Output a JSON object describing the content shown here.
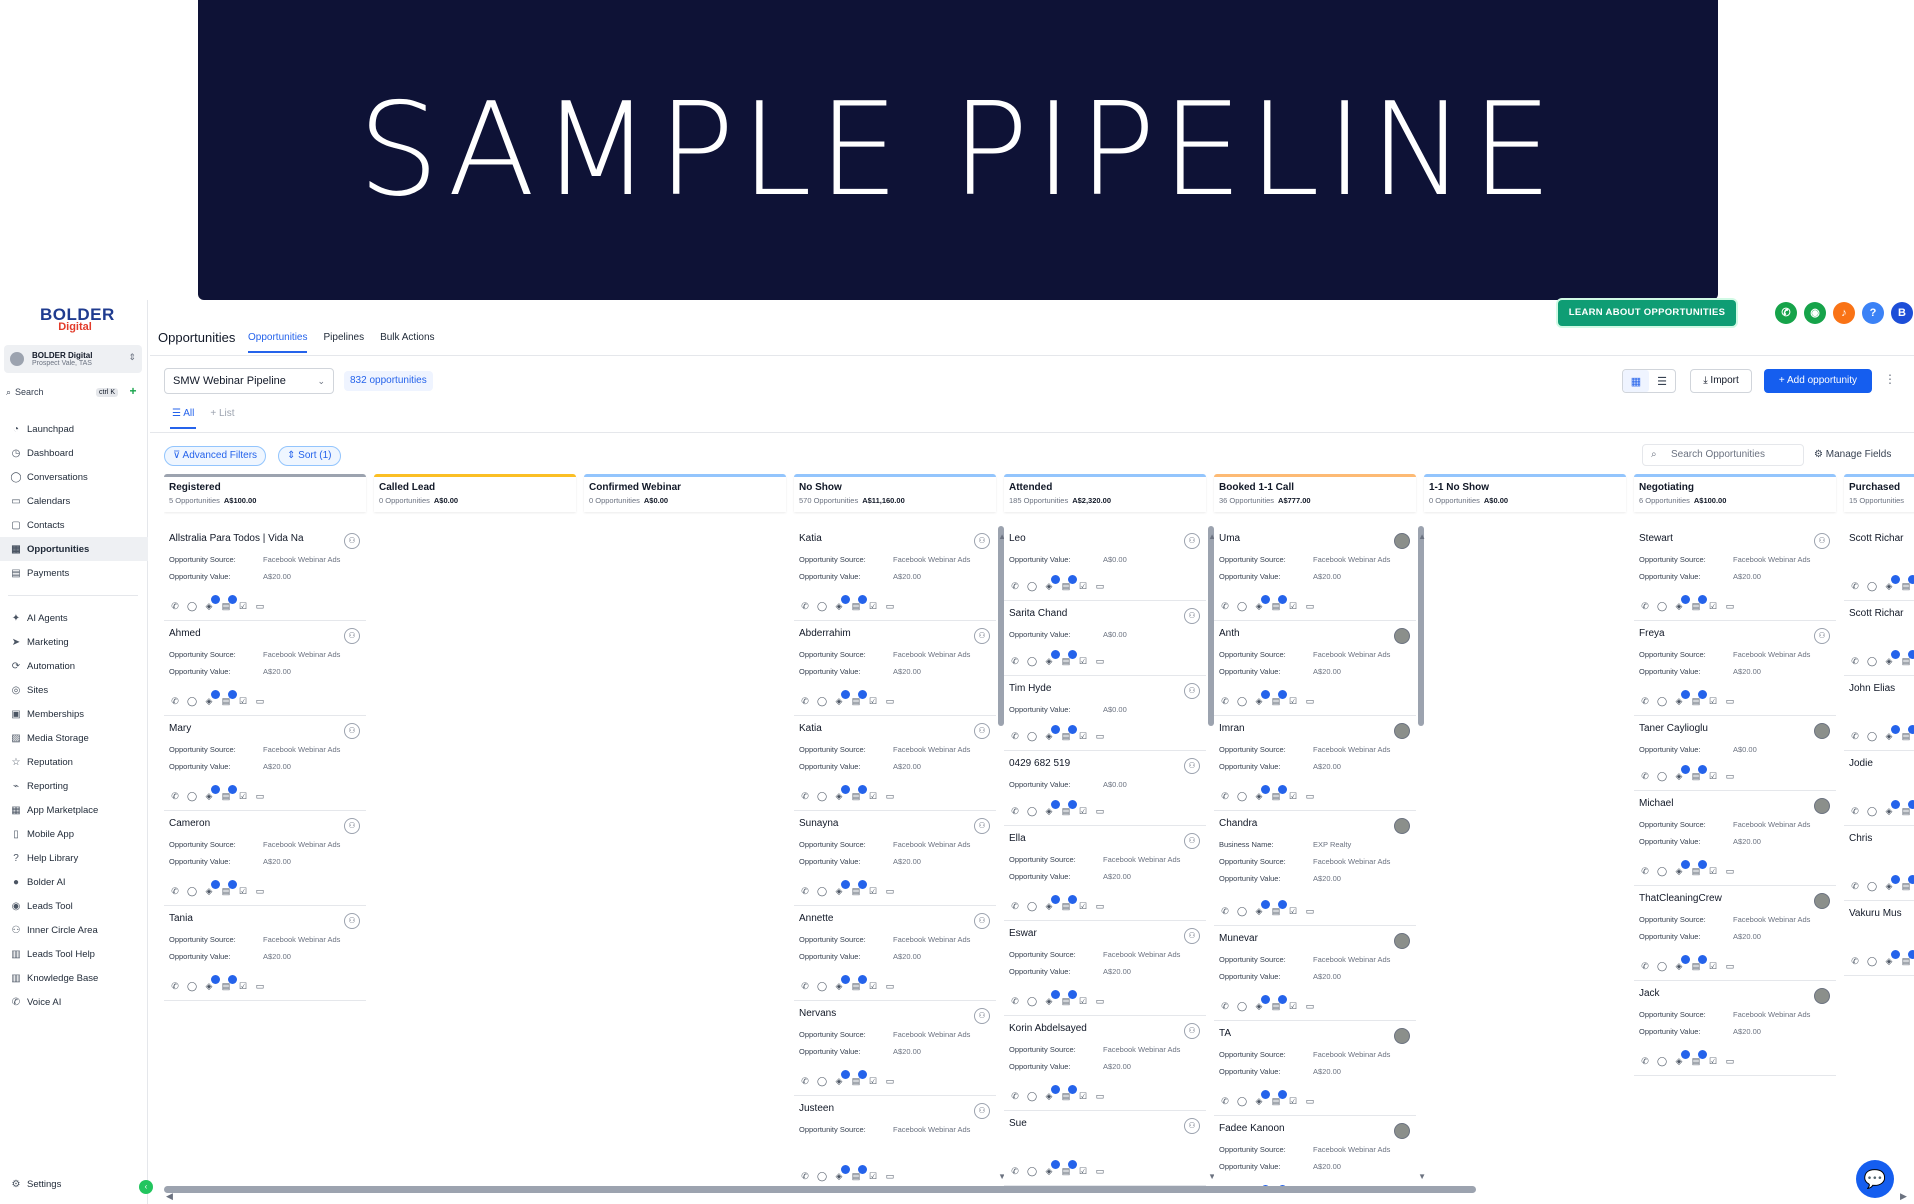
{
  "banner": {
    "title": "SAMPLE PIPELINE"
  },
  "brand": {
    "logo_line1": "BOLDER",
    "logo_line2": "Digital"
  },
  "account": {
    "name": "BOLDER Digital",
    "location": "Prospect Vale, TAS"
  },
  "search": {
    "label": "Search",
    "shortcut": "ctrl K"
  },
  "sidebar": {
    "items": [
      {
        "label": "Launchpad",
        "icon": "rocket-icon"
      },
      {
        "label": "Dashboard",
        "icon": "gauge-icon"
      },
      {
        "label": "Conversations",
        "icon": "chat-icon"
      },
      {
        "label": "Calendars",
        "icon": "calendar-icon"
      },
      {
        "label": "Contacts",
        "icon": "contacts-icon"
      },
      {
        "label": "Opportunities",
        "icon": "opportunities-icon",
        "active": true
      },
      {
        "label": "Payments",
        "icon": "payments-icon"
      }
    ],
    "items2": [
      {
        "label": "AI Agents",
        "icon": "sparkle-icon"
      },
      {
        "label": "Marketing",
        "icon": "send-icon"
      },
      {
        "label": "Automation",
        "icon": "automation-icon"
      },
      {
        "label": "Sites",
        "icon": "globe-icon"
      },
      {
        "label": "Memberships",
        "icon": "membership-icon"
      },
      {
        "label": "Media Storage",
        "icon": "image-icon"
      },
      {
        "label": "Reputation",
        "icon": "star-icon"
      },
      {
        "label": "Reporting",
        "icon": "chart-icon"
      },
      {
        "label": "App Marketplace",
        "icon": "grid-icon"
      },
      {
        "label": "Mobile App",
        "icon": "phone-icon"
      },
      {
        "label": "Help Library",
        "icon": "help-icon"
      },
      {
        "label": "Bolder AI",
        "icon": "ai-icon"
      },
      {
        "label": "Leads Tool",
        "icon": "target-icon"
      },
      {
        "label": "Inner Circle Area",
        "icon": "group-icon"
      },
      {
        "label": "Leads Tool Help",
        "icon": "book-icon"
      },
      {
        "label": "Knowledge Base",
        "icon": "book-icon"
      },
      {
        "label": "Voice AI",
        "icon": "voice-icon"
      }
    ],
    "settings": "Settings"
  },
  "header": {
    "title": "Opportunities",
    "tabs": [
      "Opportunities",
      "Pipelines",
      "Bulk Actions"
    ],
    "learn_button": "LEARN ABOUT OPPORTUNITIES",
    "avatar_letter": "B"
  },
  "toolbar": {
    "pipeline": "SMW Webinar Pipeline",
    "count": "832 opportunities",
    "import": "Import",
    "add": "Add opportunity",
    "view_all": "All",
    "view_list": "List",
    "advanced_filters": "Advanced Filters",
    "sort": "Sort (1)",
    "search_placeholder": "Search Opportunities",
    "manage_fields": "Manage Fields"
  },
  "labels": {
    "source": "Opportunity Source:",
    "value": "Opportunity Value:",
    "business": "Business Name:"
  },
  "columns": [
    {
      "name": "Registered",
      "count": "5 Opportunities",
      "total": "A$100.00",
      "color": "#9ca3af",
      "cards": [
        {
          "name": "Allstralia Para Todos | Vida Na",
          "source": "Facebook Webinar Ads",
          "value": "A$20.00"
        },
        {
          "name": "Ahmed",
          "source": "Facebook Webinar Ads",
          "value": "A$20.00"
        },
        {
          "name": "Mary",
          "source": "Facebook Webinar Ads",
          "value": "A$20.00"
        },
        {
          "name": "Cameron",
          "source": "Facebook Webinar Ads",
          "value": "A$20.00"
        },
        {
          "name": "Tania",
          "source": "Facebook Webinar Ads",
          "value": "A$20.00"
        }
      ]
    },
    {
      "name": "Called Lead",
      "count": "0 Opportunities",
      "total": "A$0.00",
      "color": "#fbbf24",
      "cards": []
    },
    {
      "name": "Confirmed Webinar",
      "count": "0 Opportunities",
      "total": "A$0.00",
      "color": "#93c5fd",
      "cards": []
    },
    {
      "name": "No Show",
      "count": "570 Opportunities",
      "total": "A$11,160.00",
      "color": "#93c5fd",
      "cards": [
        {
          "name": "Katia",
          "source": "Facebook Webinar Ads",
          "value": "A$20.00"
        },
        {
          "name": "Abderrahim",
          "source": "Facebook Webinar Ads",
          "value": "A$20.00"
        },
        {
          "name": "Katia",
          "source": "Facebook Webinar Ads",
          "value": "A$20.00"
        },
        {
          "name": "Sunayna",
          "source": "Facebook Webinar Ads",
          "value": "A$20.00"
        },
        {
          "name": "Annette",
          "source": "Facebook Webinar Ads",
          "value": "A$20.00"
        },
        {
          "name": "Nervans",
          "source": "Facebook Webinar Ads",
          "value": "A$20.00"
        },
        {
          "name": "Justeen",
          "source": "Facebook Webinar Ads",
          "value": ""
        }
      ]
    },
    {
      "name": "Attended",
      "count": "185 Opportunities",
      "total": "A$2,320.00",
      "color": "#93c5fd",
      "cards": [
        {
          "name": "Leo",
          "value": "A$0.00"
        },
        {
          "name": "Sarita Chand",
          "value": "A$0.00"
        },
        {
          "name": "Tim Hyde",
          "value": "A$0.00"
        },
        {
          "name": "0429 682 519",
          "value": "A$0.00"
        },
        {
          "name": "Ella",
          "source": "Facebook Webinar Ads",
          "value": "A$20.00"
        },
        {
          "name": "Eswar",
          "source": "Facebook Webinar Ads",
          "value": "A$20.00"
        },
        {
          "name": "Korin Abdelsayed",
          "source": "Facebook Webinar Ads",
          "value": "A$20.00"
        },
        {
          "name": "Sue",
          "value": ""
        }
      ]
    },
    {
      "name": "Booked 1-1 Call",
      "count": "36 Opportunities",
      "total": "A$777.00",
      "color": "#fdba74",
      "cards": [
        {
          "name": "Uma",
          "source": "Facebook Webinar Ads",
          "value": "A$20.00"
        },
        {
          "name": "Anth",
          "source": "Facebook Webinar Ads",
          "value": "A$20.00"
        },
        {
          "name": "Imran",
          "source": "Facebook Webinar Ads",
          "value": "A$20.00"
        },
        {
          "name": "Chandra",
          "business": "EXP Realty",
          "source": "Facebook Webinar Ads",
          "value": "A$20.00"
        },
        {
          "name": "Munevar",
          "source": "Facebook Webinar Ads",
          "value": "A$20.00"
        },
        {
          "name": "TA",
          "source": "Facebook Webinar Ads",
          "value": "A$20.00"
        },
        {
          "name": "Fadee Kanoon",
          "source": "Facebook Webinar Ads",
          "value": "A$20.00"
        }
      ]
    },
    {
      "name": "1-1 No Show",
      "count": "0 Opportunities",
      "total": "A$0.00",
      "color": "#93c5fd",
      "cards": []
    },
    {
      "name": "Negotiating",
      "count": "6 Opportunities",
      "total": "A$100.00",
      "color": "#93c5fd",
      "cards": [
        {
          "name": "Stewart",
          "source": "Facebook Webinar Ads",
          "value": "A$20.00"
        },
        {
          "name": "Freya",
          "source": "Facebook Webinar Ads",
          "value": "A$20.00"
        },
        {
          "name": "Taner Caylioglu",
          "value": "A$0.00"
        },
        {
          "name": "Michael",
          "source": "Facebook Webinar Ads",
          "value": "A$20.00"
        },
        {
          "name": "ThatCleaningCrew",
          "source": "Facebook Webinar Ads",
          "value": "A$20.00"
        },
        {
          "name": "Jack",
          "source": "Facebook Webinar Ads",
          "value": "A$20.00"
        }
      ]
    },
    {
      "name": "Purchased",
      "count": "15 Opportunities",
      "total": "",
      "color": "#93c5fd",
      "cards": [
        {
          "name": "Scott Richar",
          "business": "",
          "value": ""
        },
        {
          "name": "Scott Richar",
          "business": "",
          "value": ""
        },
        {
          "name": "John Elias",
          "business": "",
          "value": ""
        },
        {
          "name": "Jodie",
          "business": "",
          "value": ""
        },
        {
          "name": "Chris",
          "business": "",
          "value": ""
        },
        {
          "name": "Vakuru Mus",
          "business": "",
          "value": ""
        }
      ]
    }
  ]
}
